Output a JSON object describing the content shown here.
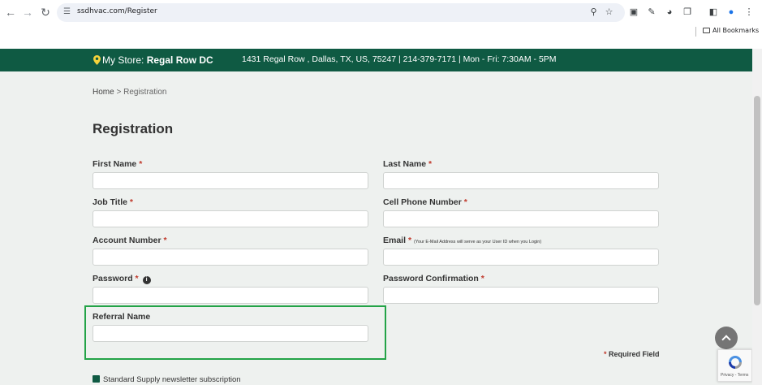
{
  "browser": {
    "url": "ssdhvac.com/Register",
    "bookmarks_label": "All Bookmarks"
  },
  "store_bar": {
    "label": "My Store:",
    "store_name": "Regal Row DC",
    "info": "1431 Regal Row , Dallas, TX, US, 75247 | 214-379-7171 | Mon - Fri: 7:30AM - 5PM"
  },
  "breadcrumb": {
    "home": "Home",
    "separator": ">",
    "current": "Registration"
  },
  "page_title": "Registration",
  "form": {
    "first_name_label": "First Name",
    "last_name_label": "Last Name",
    "job_title_label": "Job Title",
    "cell_phone_label": "Cell Phone Number",
    "account_number_label": "Account Number",
    "email_label": "Email",
    "email_note": "(Your E-Mail Address will serve as your User ID when you Login)",
    "password_label": "Password",
    "password_confirmation_label": "Password Confirmation",
    "referral_name_label": "Referral Name",
    "required_marker": "*",
    "required_legend": "Required Field",
    "newsletter_label": "Standard Supply newsletter subscription",
    "newsletter_checked": true
  },
  "recaptcha": {
    "text": "Privacy - Terms"
  },
  "colors": {
    "store_bar": "#0f5a43",
    "highlight": "#23a347",
    "required": "#c0392b"
  }
}
